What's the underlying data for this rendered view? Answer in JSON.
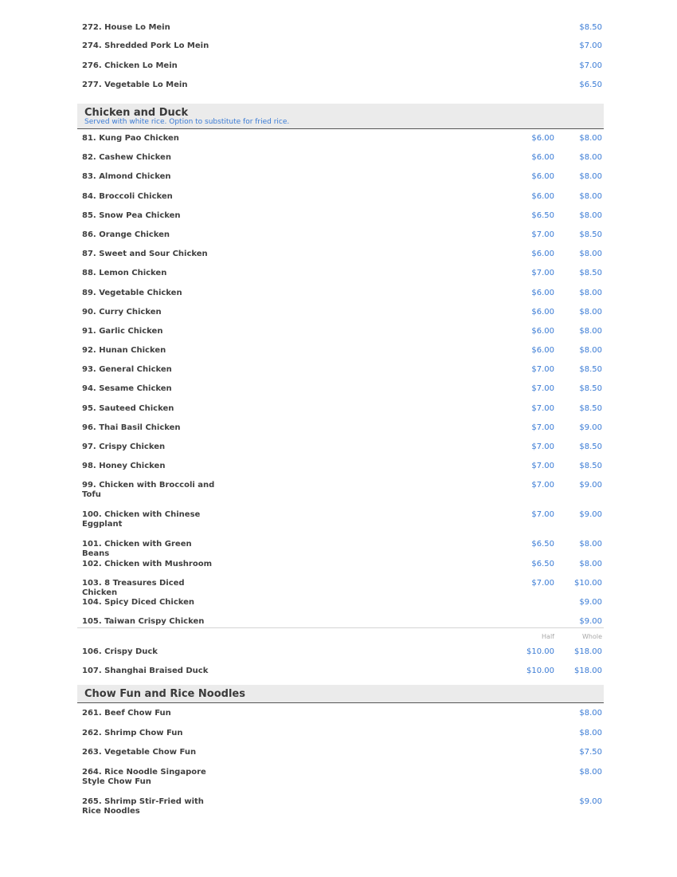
{
  "sections": {
    "lo_mein": {
      "items": [
        {
          "name": "272. House Lo Mein",
          "price1": "",
          "price2": "$8.50"
        },
        {
          "name": "274. Shredded Pork Lo Mein",
          "price1": "",
          "price2": "$7.00"
        },
        {
          "name": "276. Chicken Lo Mein",
          "price1": "",
          "price2": "$7.00"
        },
        {
          "name": "277. Vegetable Lo Mein",
          "price1": "",
          "price2": "$6.50"
        }
      ]
    },
    "chicken_duck": {
      "title": "Chicken and Duck",
      "subtitle": "Served with white rice. Option to substitute for fried rice.",
      "items": [
        {
          "name": "81. Kung Pao Chicken",
          "price1": "$6.00",
          "price2": "$8.00"
        },
        {
          "name": "82. Cashew Chicken",
          "price1": "$6.00",
          "price2": "$8.00"
        },
        {
          "name": "83. Almond Chicken",
          "price1": "$6.00",
          "price2": "$8.00"
        },
        {
          "name": "84. Broccoli Chicken",
          "price1": "$6.00",
          "price2": "$8.00"
        },
        {
          "name": "85. Snow Pea Chicken",
          "price1": "$6.50",
          "price2": "$8.00"
        },
        {
          "name": "86. Orange Chicken",
          "price1": "$7.00",
          "price2": "$8.50"
        },
        {
          "name": "87. Sweet and Sour Chicken",
          "price1": "$6.00",
          "price2": "$8.00"
        },
        {
          "name": "88. Lemon Chicken",
          "price1": "$7.00",
          "price2": "$8.50"
        },
        {
          "name": "89. Vegetable Chicken",
          "price1": "$6.00",
          "price2": "$8.00"
        },
        {
          "name": "90. Curry Chicken",
          "price1": "$6.00",
          "price2": "$8.00"
        },
        {
          "name": "91. Garlic Chicken",
          "price1": "$6.00",
          "price2": "$8.00"
        },
        {
          "name": "92. Hunan Chicken",
          "price1": "$6.00",
          "price2": "$8.00"
        },
        {
          "name": "93. General Chicken",
          "price1": "$7.00",
          "price2": "$8.50"
        },
        {
          "name": "94. Sesame Chicken",
          "price1": "$7.00",
          "price2": "$8.50"
        },
        {
          "name": "95. Sauteed Chicken",
          "price1": "$7.00",
          "price2": "$8.50"
        },
        {
          "name": "96. Thai Basil Chicken",
          "price1": "$7.00",
          "price2": "$9.00"
        },
        {
          "name": "97. Crispy Chicken",
          "price1": "$7.00",
          "price2": "$8.50"
        },
        {
          "name": "98. Honey Chicken",
          "price1": "$7.00",
          "price2": "$8.50"
        },
        {
          "name": "99. Chicken with Broccoli and Tofu",
          "price1": "$7.00",
          "price2": "$9.00"
        },
        {
          "name": "100. Chicken with Chinese Eggplant",
          "price1": "$7.00",
          "price2": "$9.00"
        },
        {
          "name": "101. Chicken with Green Beans",
          "price1": "$6.50",
          "price2": "$8.00"
        },
        {
          "name": "102. Chicken with Mushroom",
          "price1": "$6.50",
          "price2": "$8.00"
        },
        {
          "name": "103. 8 Treasures Diced Chicken",
          "price1": "$7.00",
          "price2": "$10.00"
        },
        {
          "name": "104. Spicy Diced Chicken",
          "price1": "",
          "price2": "$9.00"
        },
        {
          "name": "105. Taiwan Crispy Chicken",
          "price1": "",
          "price2": "$9.00"
        }
      ],
      "size_labels": {
        "half": "Half",
        "whole": "Whole"
      },
      "duck_items": [
        {
          "name": "106. Crispy Duck",
          "price1": "$10.00",
          "price2": "$18.00"
        },
        {
          "name": "107. Shanghai Braised Duck",
          "price1": "$10.00",
          "price2": "$18.00"
        }
      ]
    },
    "chow_fun": {
      "title": "Chow Fun and Rice Noodles",
      "items": [
        {
          "name": "261. Beef Chow Fun",
          "price1": "",
          "price2": "$8.00"
        },
        {
          "name": "262. Shrimp Chow Fun",
          "price1": "",
          "price2": "$8.00"
        },
        {
          "name": "263. Vegetable Chow Fun",
          "price1": "",
          "price2": "$7.50"
        },
        {
          "name": "264. Rice Noodle Singapore Style Chow Fun",
          "price1": "",
          "price2": "$8.00"
        },
        {
          "name": "265. Shrimp Stir-Fried with Rice Noodles",
          "price1": "",
          "price2": "$9.00"
        }
      ]
    }
  },
  "colors": {
    "price": "#3a7bd5",
    "header_bg": "#ebebeb",
    "item_text": "#3f3f3f"
  }
}
